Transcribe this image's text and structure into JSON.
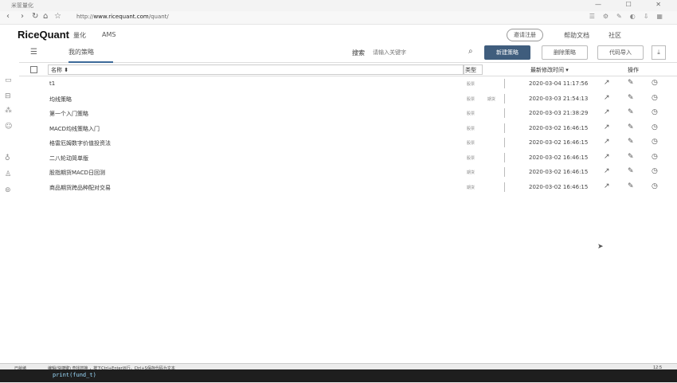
{
  "window": {
    "title": "米筐量化",
    "controls": "— ☐ ✕"
  },
  "browser": {
    "url_prefix": "http://",
    "url_host": "www.ricequant.com",
    "url_path": "/quant/"
  },
  "header": {
    "logo": "RiceQuant",
    "nav": [
      "量化",
      "AMS"
    ],
    "invite_button": "邀请注册",
    "help_doc": "帮助文档",
    "community": "社区"
  },
  "toolbar": {
    "tab": "我的策略",
    "search_label": "搜索",
    "search_placeholder": "请输入关键字",
    "new_button": "新建策略",
    "delete_button": "删除策略",
    "import_button": "代码导入"
  },
  "table": {
    "headers": {
      "name": "名称 ⬍",
      "type": "类型",
      "modified": "最新修改时间 ▾",
      "actions": "操作"
    },
    "rows": [
      {
        "name": "t1",
        "type": "股票",
        "tag": "",
        "modified": "2020-03-04 11:17:56"
      },
      {
        "name": "均线策略",
        "type": "股票",
        "tag": "期货",
        "modified": "2020-03-03 21:54:13"
      },
      {
        "name": "第一个入门策略",
        "type": "股票",
        "tag": "",
        "modified": "2020-03-03 21:38:29"
      },
      {
        "name": "MACD均线策略入门",
        "type": "股票",
        "tag": "",
        "modified": "2020-03-02 16:46:15"
      },
      {
        "name": "格雷厄姆数字价值投资法",
        "type": "股票",
        "tag": "",
        "modified": "2020-03-02 16:46:15"
      },
      {
        "name": "二八轮动简单版",
        "type": "股票",
        "tag": "",
        "modified": "2020-03-02 16:46:15"
      },
      {
        "name": "股指期货MACD日回测",
        "type": "期货",
        "tag": "",
        "modified": "2020-03-02 16:46:15"
      },
      {
        "name": "商品期货跨品种配对交易",
        "type": "期货",
        "tag": "",
        "modified": "2020-03-02 16:46:15"
      }
    ]
  },
  "taskbar": {
    "status": "已就绪",
    "hint": "编辑(快捷键) 查找替换 ，按下Ctrl+Enter运行，Ctrl+S保存代码为文本",
    "code": "print(fund_t)",
    "clock": "12:5"
  }
}
